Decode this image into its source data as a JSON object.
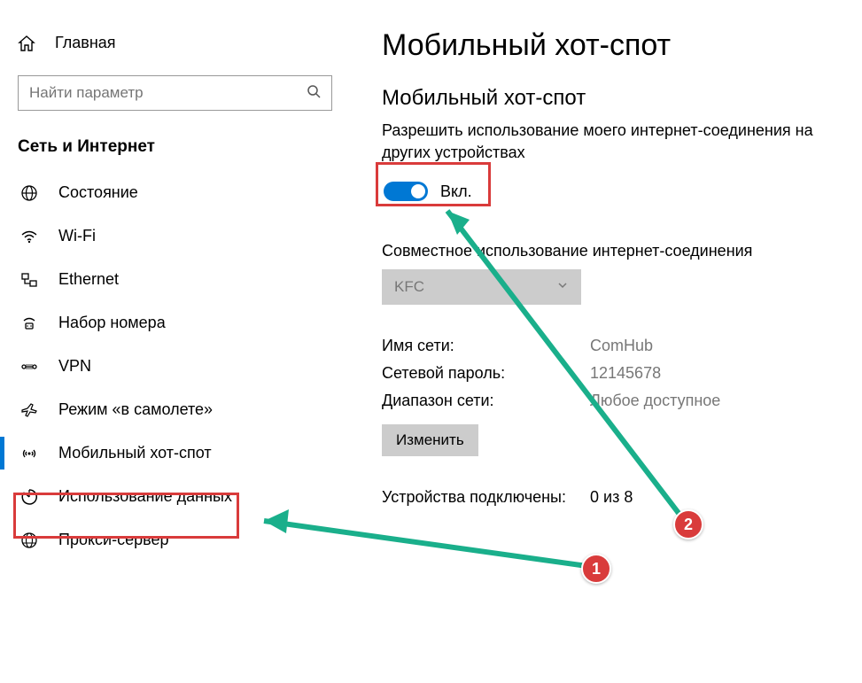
{
  "sidebar": {
    "home": "Главная",
    "search_placeholder": "Найти параметр",
    "section": "Сеть и Интернет",
    "items": [
      {
        "label": "Состояние",
        "icon": "globe-icon"
      },
      {
        "label": "Wi-Fi",
        "icon": "wifi-icon"
      },
      {
        "label": "Ethernet",
        "icon": "ethernet-icon"
      },
      {
        "label": "Набор номера",
        "icon": "dialup-icon"
      },
      {
        "label": "VPN",
        "icon": "vpn-icon"
      },
      {
        "label": "Режим «в самолете»",
        "icon": "airplane-icon"
      },
      {
        "label": "Мобильный хот-спот",
        "icon": "hotspot-icon"
      },
      {
        "label": "Использование данных",
        "icon": "data-usage-icon"
      },
      {
        "label": "Прокси-сервер",
        "icon": "proxy-icon"
      }
    ]
  },
  "main": {
    "title": "Мобильный хот-спот",
    "hotspot": {
      "subtitle": "Мобильный хот-спот",
      "desc": "Разрешить использование моего интернет-соединения на других устройствах",
      "toggle_label": "Вкл.",
      "toggle_on": true
    },
    "share": {
      "label": "Совместное использование интернет-соединения",
      "selected": "KFC"
    },
    "network": {
      "name_label": "Имя сети:",
      "name_value": "ComHub",
      "password_label": "Сетевой пароль:",
      "password_value": "12145678",
      "band_label": "Диапазон сети:",
      "band_value": "Любое доступное",
      "edit_button": "Изменить"
    },
    "devices": {
      "label": "Устройства подключены:",
      "value": "0 из 8"
    }
  },
  "annotations": {
    "bubble1": "1",
    "bubble2": "2"
  },
  "colors": {
    "accent": "#0078d4",
    "annotation_red": "#d93b3b",
    "annotation_green": "#1aaf8b"
  }
}
